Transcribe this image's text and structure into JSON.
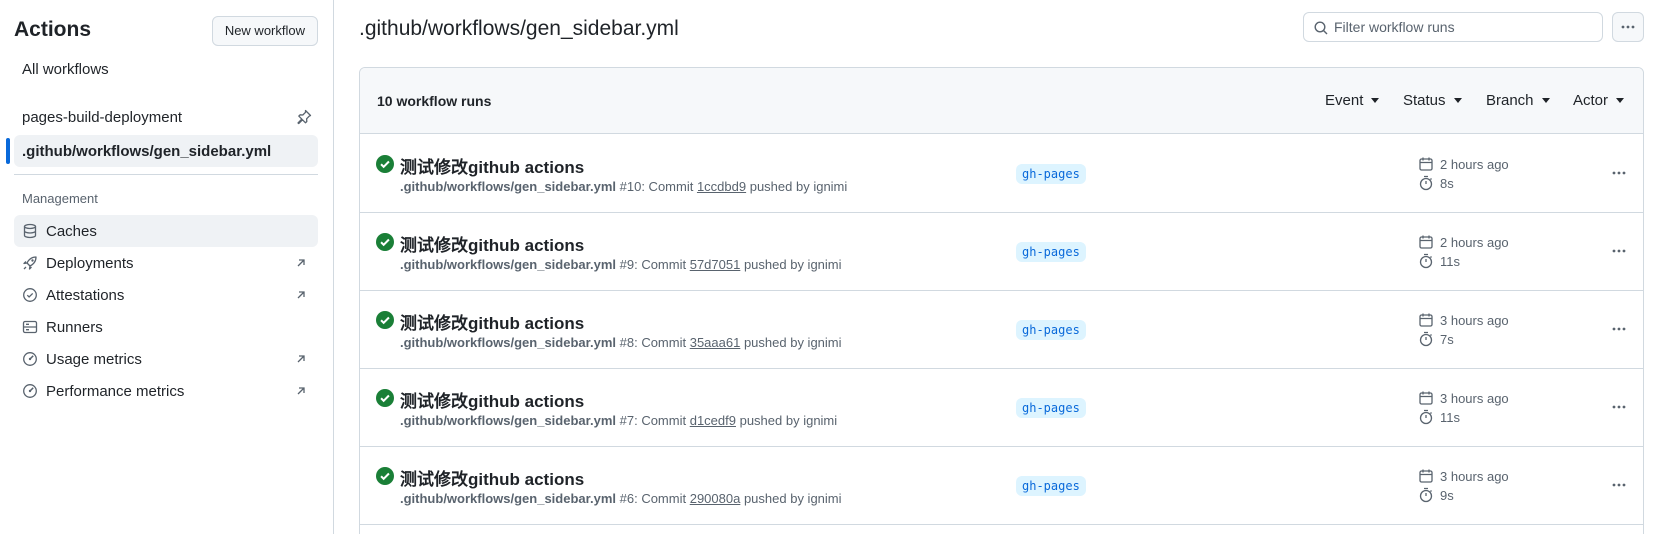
{
  "sidebar": {
    "title": "Actions",
    "new_workflow_label": "New workflow",
    "all_workflows_label": "All workflows",
    "workflows": [
      {
        "label": "pages-build-deployment",
        "pinned": true
      },
      {
        "label": ".github/workflows/gen_sidebar.yml",
        "active": true
      }
    ],
    "management_label": "Management",
    "management": [
      {
        "label": "Caches",
        "icon": "database-icon"
      },
      {
        "label": "Deployments",
        "icon": "rocket-icon"
      },
      {
        "label": "Attestations",
        "icon": "verified-icon"
      },
      {
        "label": "Runners",
        "icon": "server-icon"
      },
      {
        "label": "Usage metrics",
        "icon": "meter-icon"
      },
      {
        "label": "Performance metrics",
        "icon": "meter-icon"
      }
    ]
  },
  "main": {
    "title": ".github/workflows/gen_sidebar.yml",
    "filter_placeholder": "Filter workflow runs",
    "runs_count": "10 workflow runs",
    "filters": [
      "Event",
      "Status",
      "Branch",
      "Actor"
    ],
    "runs": [
      {
        "title": "测试修改github actions",
        "workflow": ".github/workflows/gen_sidebar.yml",
        "number": "#10",
        "commit_prefix": ": Commit ",
        "sha": "1ccdbd9",
        "pushed": " pushed by ignimi",
        "branch": "gh-pages",
        "when": "2 hours ago",
        "duration": "8s"
      },
      {
        "title": "测试修改github actions",
        "workflow": ".github/workflows/gen_sidebar.yml",
        "number": "#9",
        "commit_prefix": ": Commit ",
        "sha": "57d7051",
        "pushed": " pushed by ignimi",
        "branch": "gh-pages",
        "when": "2 hours ago",
        "duration": "11s"
      },
      {
        "title": "测试修改github actions",
        "workflow": ".github/workflows/gen_sidebar.yml",
        "number": "#8",
        "commit_prefix": ": Commit ",
        "sha": "35aaa61",
        "pushed": " pushed by ignimi",
        "branch": "gh-pages",
        "when": "3 hours ago",
        "duration": "7s"
      },
      {
        "title": "测试修改github actions",
        "workflow": ".github/workflows/gen_sidebar.yml",
        "number": "#7",
        "commit_prefix": ": Commit ",
        "sha": "d1cedf9",
        "pushed": " pushed by ignimi",
        "branch": "gh-pages",
        "when": "3 hours ago",
        "duration": "11s"
      },
      {
        "title": "测试修改github actions",
        "workflow": ".github/workflows/gen_sidebar.yml",
        "number": "#6",
        "commit_prefix": ": Commit ",
        "sha": "290080a",
        "pushed": " pushed by ignimi",
        "branch": "gh-pages",
        "when": "3 hours ago",
        "duration": "9s"
      }
    ]
  },
  "colors": {
    "accent": "#0969da",
    "success": "#1a7f37",
    "branch_bg": "#ddf4ff",
    "border": "#d1d9e0"
  }
}
